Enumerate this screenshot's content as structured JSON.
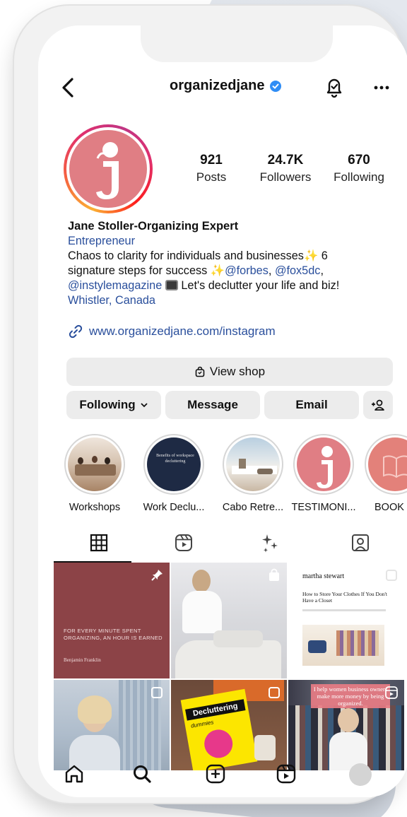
{
  "header": {
    "username": "organizedjane"
  },
  "stats": [
    {
      "value": "921",
      "label": "Posts"
    },
    {
      "value": "24.7K",
      "label": "Followers"
    },
    {
      "value": "670",
      "label": "Following"
    }
  ],
  "bio": {
    "name": "Jane Stoller-Organizing Expert",
    "category": "Entrepreneur",
    "line1": "Chaos to clarity for individuals and businesses",
    "line1_end": " 6",
    "line2_start": "signature steps for success",
    "mention_forbes": "@forbes",
    "sep": ", ",
    "mention_fox": "@fox5dc",
    "line2_end": ",",
    "mention_instyle": "@instylemagazine",
    "line3_end": " Let's declutter your life and biz!",
    "location": "Whistler, Canada",
    "website": "www.organizedjane.com/instagram"
  },
  "buttons": {
    "view_shop": "View shop",
    "following": "Following",
    "message": "Message",
    "email": "Email"
  },
  "highlights": [
    {
      "label": "Workshops"
    },
    {
      "label": "Work Declu..."
    },
    {
      "label": "Cabo Retre..."
    },
    {
      "label": "TESTIMONI..."
    },
    {
      "label": "BOOK"
    }
  ],
  "highlight_text": {
    "work_small": "Benefits of workspace decluttering"
  },
  "posts": {
    "quote": "FOR EVERY MINUTE SPENT ORGANIZING, AN HOUR IS EARNED",
    "quote_author": "Benjamin Franklin",
    "ms_brand": "martha stewart",
    "ms_headline": "How to Store Your Clothes If You Don't Have a Closet",
    "book_title": "Decluttering",
    "book_sub": "dummies",
    "overlay_text": "I help women business owners make more money by being organized."
  },
  "colors": {
    "link": "#2a4f9c",
    "verified": "#2f8df5",
    "avatar_bg": "#e07e84",
    "button_bg": "#ececec",
    "quote_bg": "#8c4347"
  },
  "icons": {
    "back": "chevron-left-icon",
    "verified": "verified-badge-icon",
    "notifications": "bell-check-icon",
    "more": "more-dots-icon",
    "link": "link-icon",
    "shop": "shopping-bag-icon",
    "add_person": "add-person-icon",
    "grid": "grid-icon",
    "reels": "reels-icon",
    "ai": "sparkles-icon",
    "tagged": "tagged-icon",
    "home": "home-icon",
    "search": "search-icon",
    "create": "plus-square-icon",
    "nav_reels": "reels-icon",
    "pin": "pin-icon"
  }
}
